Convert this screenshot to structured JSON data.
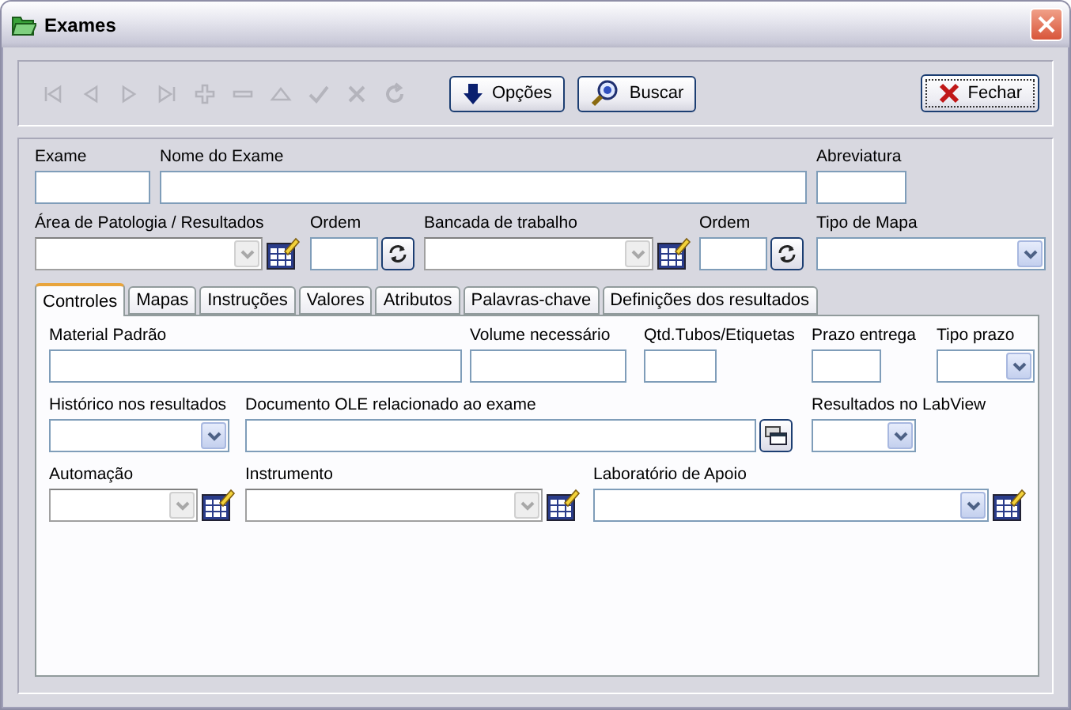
{
  "window": {
    "title": "Exames"
  },
  "toolbar": {
    "nav_buttons": [
      {
        "kind": "first",
        "disabled": true
      },
      {
        "kind": "prev",
        "disabled": true
      },
      {
        "kind": "next",
        "disabled": true
      },
      {
        "kind": "last",
        "disabled": true
      },
      {
        "kind": "add",
        "disabled": true
      },
      {
        "kind": "remove",
        "disabled": true
      },
      {
        "kind": "edit",
        "disabled": true
      },
      {
        "kind": "confirm",
        "disabled": true
      },
      {
        "kind": "cancel",
        "disabled": true
      },
      {
        "kind": "refresh",
        "disabled": true
      }
    ],
    "buttons": [
      {
        "kind": "options",
        "label": "Opções"
      },
      {
        "kind": "search",
        "label": "Buscar"
      },
      {
        "kind": "close",
        "label": "Fechar"
      }
    ]
  },
  "header_rows": [
    [
      {
        "label": "Exame",
        "kind": "text"
      },
      {
        "label": "Nome do Exame",
        "kind": "text"
      },
      {
        "label": "Abreviatura",
        "kind": "text"
      }
    ],
    [
      {
        "label": "Área de Patologia / Resultados",
        "kind": "combo",
        "disabled": true,
        "lookup_button": true
      },
      {
        "label": "Ordem",
        "kind": "text",
        "refresh_button": true
      },
      {
        "label": "Bancada de trabalho",
        "kind": "combo",
        "disabled": true,
        "lookup_button": true
      },
      {
        "label": "Ordem",
        "kind": "text",
        "refresh_button": true
      },
      {
        "label": "Tipo de Mapa",
        "kind": "combo",
        "disabled": false
      }
    ]
  ],
  "tabs": [
    {
      "label": "Controles",
      "selected": true
    },
    {
      "label": "Mapas",
      "selected": false
    },
    {
      "label": "Instruções",
      "selected": false
    },
    {
      "label": "Valores",
      "selected": false
    },
    {
      "label": "Atributos",
      "selected": false
    },
    {
      "label": "Palavras-chave",
      "selected": false
    },
    {
      "label": "Definições dos resultados",
      "selected": false
    }
  ],
  "tab_rows": [
    [
      {
        "label": "Material Padrão",
        "kind": "text"
      },
      {
        "label": "Volume necessário",
        "kind": "text"
      },
      {
        "label": "Qtd.Tubos/Etiquetas",
        "kind": "text"
      },
      {
        "label": "Prazo entrega",
        "kind": "text"
      },
      {
        "label": "Tipo prazo",
        "kind": "combo",
        "disabled": false
      }
    ],
    [
      {
        "label": "Histórico nos resultados",
        "kind": "combo",
        "disabled": false
      },
      {
        "label": "Documento OLE relacionado ao exame",
        "kind": "text",
        "browse_button": true
      },
      {
        "label": "Resultados no LabView",
        "kind": "combo",
        "disabled": false
      }
    ],
    [
      {
        "label": "Automação",
        "kind": "combo",
        "disabled": true,
        "lookup_button": true
      },
      {
        "label": "Instrumento",
        "kind": "combo",
        "disabled": true,
        "lookup_button": true
      },
      {
        "label": "Laboratório de Apoio",
        "kind": "combo",
        "disabled": false,
        "lookup_button": true
      }
    ]
  ]
}
